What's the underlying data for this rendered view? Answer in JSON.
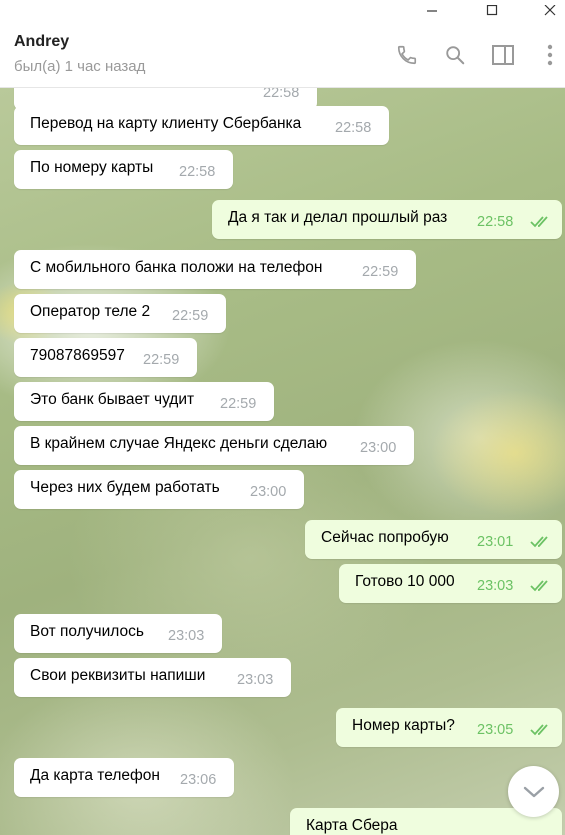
{
  "header": {
    "name": "Andrey",
    "status": "был(а) 1 час назад"
  },
  "icons": {
    "minimize": "minimize-icon",
    "maximize": "maximize-icon",
    "close": "close-icon",
    "phone": "phone-icon",
    "search": "search-icon",
    "sidebar": "sidebar-toggle-icon",
    "more": "more-vertical-icon",
    "scroll_down": "chevron-down-icon",
    "read": "double-check-icon"
  },
  "colors": {
    "incoming_bubble": "#ffffff",
    "outgoing_bubble": "#effdde",
    "outgoing_time": "#6cc264",
    "incoming_time": "#a4a9ad"
  },
  "messages": [
    {
      "dir": "in",
      "text": "",
      "time": "22:58"
    },
    {
      "dir": "in",
      "text": "Перевод на карту клиенту Сбербанка",
      "time": "22:58"
    },
    {
      "dir": "in",
      "text": "По номеру карты",
      "time": "22:58"
    },
    {
      "dir": "out",
      "text": "Да я так и делал прошлый раз",
      "time": "22:58"
    },
    {
      "dir": "in",
      "text": "С мобильного банка положи на телефон",
      "time": "22:59"
    },
    {
      "dir": "in",
      "text": "Оператор теле 2",
      "time": "22:59"
    },
    {
      "dir": "in",
      "text": "79087869597",
      "time": "22:59"
    },
    {
      "dir": "in",
      "text": "Это банк бывает чудит",
      "time": "22:59"
    },
    {
      "dir": "in",
      "text": "В крайнем случае Яндекс деньги сделаю",
      "time": "23:00"
    },
    {
      "dir": "in",
      "text": "Через них будем работать",
      "time": "23:00"
    },
    {
      "dir": "out",
      "text": "Сейчас попробую",
      "time": "23:01"
    },
    {
      "dir": "out",
      "text": "Готово 10 000",
      "time": "23:03"
    },
    {
      "dir": "in",
      "text": "Вот получилось",
      "time": "23:03"
    },
    {
      "dir": "in",
      "text": "Свои реквизиты напиши",
      "time": "23:03"
    },
    {
      "dir": "out",
      "text": "Номер карты?",
      "time": "23:05"
    },
    {
      "dir": "in",
      "text": "Да карта телефон",
      "time": "23:06"
    },
    {
      "dir": "out",
      "text": "Карта Сбера",
      "time": ""
    }
  ]
}
